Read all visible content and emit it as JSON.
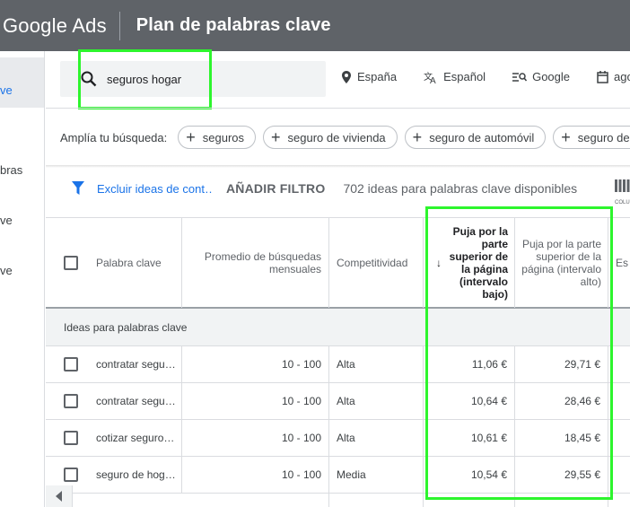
{
  "appbar": {
    "brand_google": "Google",
    "brand_ads": "Ads",
    "title": "Plan de palabras clave"
  },
  "leftnav": {
    "items": [
      "ve",
      "bras",
      "ve",
      "ve"
    ]
  },
  "search": {
    "value": "seguros hogar"
  },
  "top_filters": [
    {
      "icon": "location-pin-icon",
      "label": "España"
    },
    {
      "icon": "translate-icon",
      "label": "Español"
    },
    {
      "icon": "search-network-icon",
      "label": "Google"
    },
    {
      "icon": "calendar-icon",
      "label": "ago"
    }
  ],
  "broaden": {
    "label": "Amplía tu búsqueda:",
    "chips": [
      "seguros",
      "seguro de vivienda",
      "seguro de automóvil",
      "seguro de"
    ]
  },
  "filter_row": {
    "exclude": "Excluir ideas de cont…",
    "add_filter": "AÑADIR FILTRO",
    "count": "702 ideas para palabras clave disponibles",
    "columns": "COLUMNAS"
  },
  "table": {
    "headers": {
      "keyword": "Palabra clave",
      "avg": "Promedio de búsquedas mensuales",
      "competition": "Competitividad",
      "bid_low": "Puja por la parte superior de la página (intervalo bajo)",
      "bid_high": "Puja por la parte superior de la página (intervalo alto)",
      "next": "Es"
    },
    "group_label": "Ideas para palabras clave",
    "rows": [
      {
        "keyword": "contratar segu…",
        "avg": "10 - 100",
        "competition": "Alta",
        "low": "11,06 €",
        "high": "29,71 €"
      },
      {
        "keyword": "contratar segu…",
        "avg": "10 - 100",
        "competition": "Alta",
        "low": "10,64 €",
        "high": "28,46 €"
      },
      {
        "keyword": "cotizar seguro…",
        "avg": "10 - 100",
        "competition": "Alta",
        "low": "10,61 €",
        "high": "18,45 €"
      },
      {
        "keyword": "seguro de hog…",
        "avg": "10 - 100",
        "competition": "Media",
        "low": "10,54 €",
        "high": "29,55 €"
      }
    ]
  },
  "colors": {
    "appbar": "#5f6368",
    "accent": "#1a73e8",
    "highlight": "#2df52d"
  }
}
